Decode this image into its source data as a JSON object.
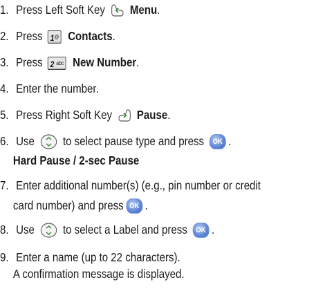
{
  "steps": [
    {
      "num": "1.",
      "pre": "Press Left Soft Key",
      "bold": "Menu",
      "post": "."
    },
    {
      "num": "2.",
      "pre": "Press",
      "key_main": "1",
      "key_sub": "@",
      "bold": "Contacts",
      "post": "."
    },
    {
      "num": "3.",
      "pre": "Press",
      "key_main": "2",
      "key_sub": "abc",
      "bold": "New Number",
      "post": "."
    },
    {
      "num": "4.",
      "text": "Enter the number."
    },
    {
      "num": "5.",
      "pre": "Press Right Soft Key",
      "bold": "Pause",
      "post": "."
    },
    {
      "num": "6.",
      "pre": "Use",
      "mid": "to select pause type and press",
      "post": ".",
      "line2": "Hard Pause / 2-sec Pause"
    },
    {
      "num": "7.",
      "line1": "Enter additional number(s) (e.g., pin number or credit",
      "line2": "card number) and press",
      "post": "."
    },
    {
      "num": "8.",
      "pre": "Use",
      "mid": "to select a Label and press",
      "post": "."
    },
    {
      "num": "9.",
      "line1": "Enter a name (up to 22 characters).",
      "line2": "A confirmation message is displayed."
    }
  ],
  "ok_label": "OK",
  "icons": {
    "left_soft_key": "left-soft-key-icon",
    "right_soft_key": "right-soft-key-icon",
    "nav_key": "navigation-key-icon",
    "ok_key": "ok-key-icon"
  }
}
